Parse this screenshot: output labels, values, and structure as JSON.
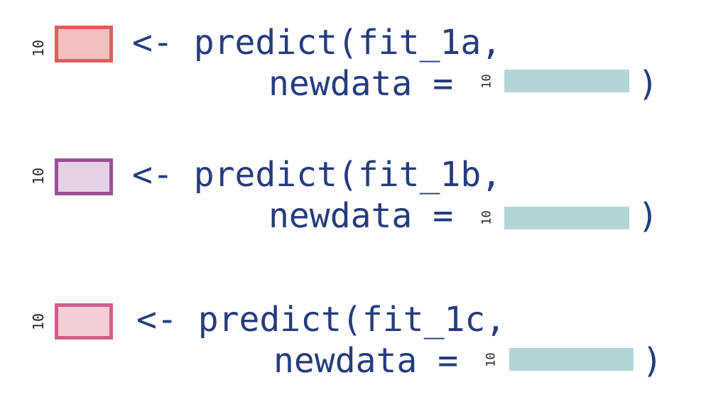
{
  "colors": {
    "code_text": "#243b7d",
    "teal_bar": "#b2d6d8",
    "box1_border": "#d9605e",
    "box1_fill": "#f1bfbd",
    "box2_border": "#9b4f96",
    "box2_fill": "#e4d1e6",
    "box3_border": "#d45b8b",
    "box3_fill": "#f3cfd5"
  },
  "blocks": [
    {
      "dim_label": "10",
      "line1": "<- predict(fit_1a,",
      "line2": "newdata =",
      "newdata_dim_label": "10",
      "close_paren": ")"
    },
    {
      "dim_label": "10",
      "line1": "<- predict(fit_1b,",
      "line2": "newdata =",
      "newdata_dim_label": "10",
      "close_paren": ")"
    },
    {
      "dim_label": "10",
      "line1": "<- predict(fit_1c,",
      "line2": "newdata =",
      "newdata_dim_label": "10",
      "close_paren": ")"
    }
  ]
}
